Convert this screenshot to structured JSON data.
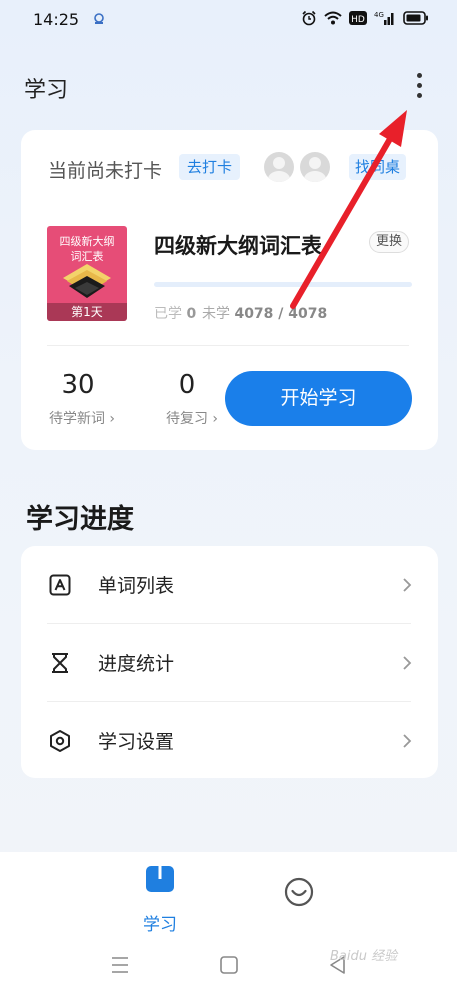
{
  "status_bar": {
    "time": "14:25",
    "signal_label": "4G",
    "hd_label": "HD"
  },
  "header": {
    "title": "学习"
  },
  "checkin": {
    "status_text": "当前尚未打卡",
    "checkin_button": "去打卡",
    "find_desk_button": "找同桌"
  },
  "book": {
    "cover_title": "四级新大纲词汇表",
    "cover_day": "第1天",
    "name": "四级新大纲词汇表",
    "change_button": "更换",
    "learned_label": "已学",
    "learned_value": "0",
    "unlearned_label": "未学",
    "unlearned_value": "4078 / 4078",
    "progress_fraction": 0
  },
  "study": {
    "new_count": "30",
    "new_label": "待学新词 ›",
    "review_count": "0",
    "review_label": "待复习 ›",
    "start_button": "开始学习"
  },
  "section": {
    "title": "学习进度"
  },
  "menu": {
    "items": [
      {
        "label": "单词列表",
        "icon": "letter-a-icon"
      },
      {
        "label": "进度统计",
        "icon": "hourglass-icon"
      },
      {
        "label": "学习设置",
        "icon": "settings-hexagon-icon"
      }
    ]
  },
  "bottom_nav": {
    "learn_label": "学习"
  },
  "watermark": {
    "text": "Baidu 经验"
  },
  "colors": {
    "accent": "#1f7fe0",
    "button": "#1a7fea",
    "cover": "#e64d77",
    "annotation_arrow": "#e8202a"
  }
}
